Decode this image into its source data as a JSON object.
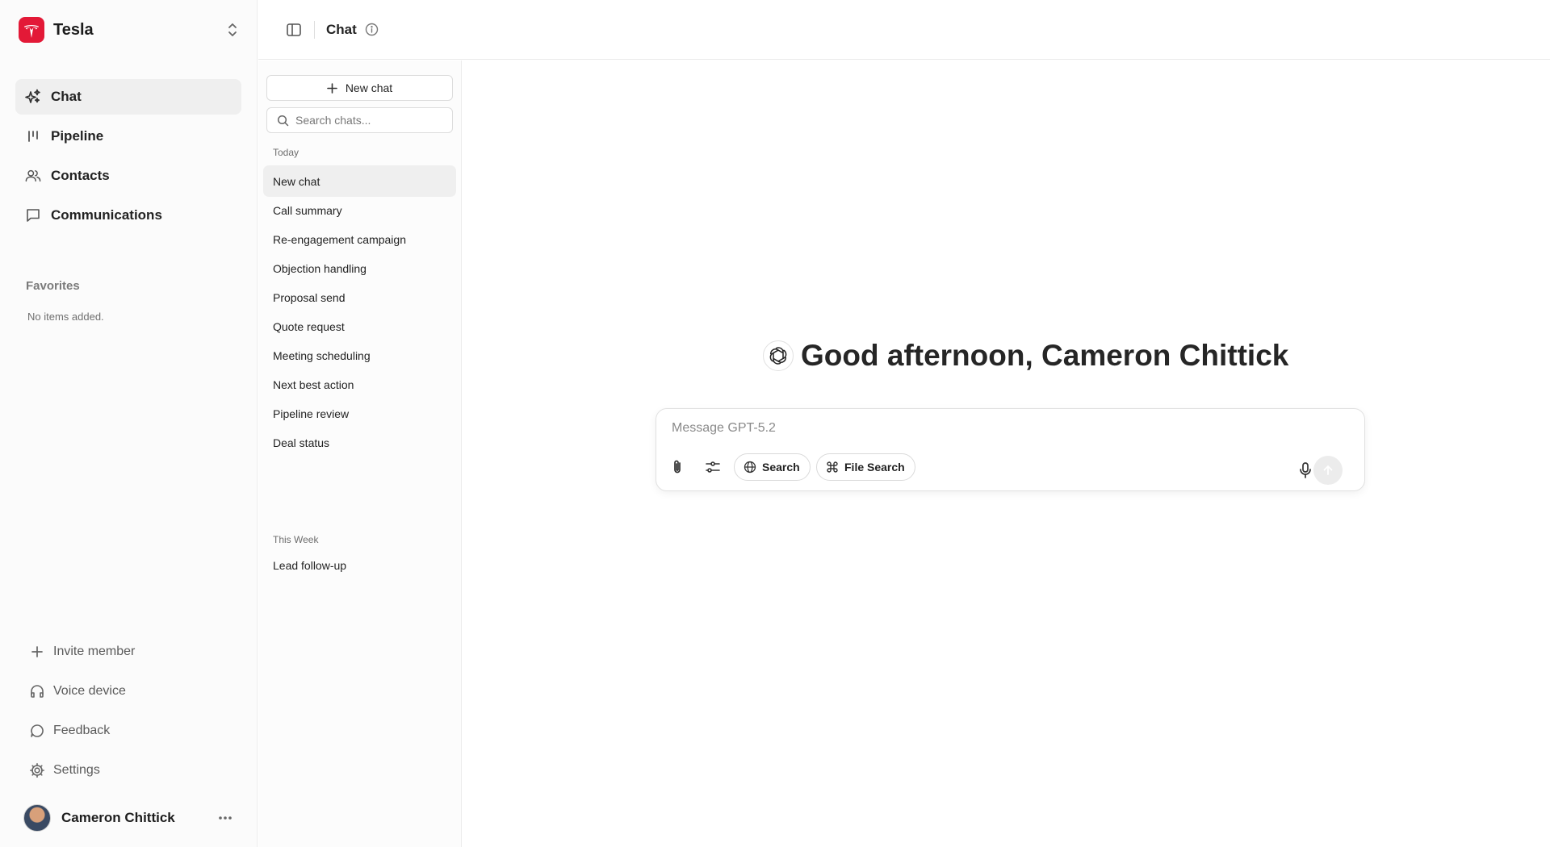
{
  "workspace": {
    "name": "Tesla",
    "accent": "#e31937"
  },
  "nav": [
    {
      "label": "Chat",
      "icon": "sparkles-icon",
      "active": true
    },
    {
      "label": "Pipeline",
      "icon": "pipeline-icon"
    },
    {
      "label": "Contacts",
      "icon": "users-icon"
    },
    {
      "label": "Communications",
      "icon": "message-square-icon"
    }
  ],
  "favorites": {
    "title": "Favorites",
    "empty_text": "No items added."
  },
  "bottom_nav": [
    {
      "label": "Invite member",
      "icon": "plus-icon"
    },
    {
      "label": "Voice device",
      "icon": "headphones-icon"
    },
    {
      "label": "Feedback",
      "icon": "message-circle-icon"
    },
    {
      "label": "Settings",
      "icon": "gear-icon"
    }
  ],
  "user": {
    "name": "Cameron Chittick"
  },
  "header": {
    "title": "Chat"
  },
  "chat_list": {
    "new_chat_label": "New chat",
    "search_placeholder": "Search chats...",
    "groups": [
      {
        "label": "Today",
        "items": [
          "New chat",
          "Call summary",
          "Re-engagement campaign",
          "Objection handling",
          "Proposal send",
          "Quote request",
          "Meeting scheduling",
          "Next best action",
          "Pipeline review",
          "Deal status"
        ]
      },
      {
        "label": "This Week",
        "items": [
          "Lead follow-up"
        ]
      }
    ]
  },
  "main": {
    "greeting": "Good afternoon, Cameron Chittick",
    "composer": {
      "placeholder": "Message GPT-5.2",
      "search_label": "Search",
      "file_search_label": "File Search"
    }
  }
}
